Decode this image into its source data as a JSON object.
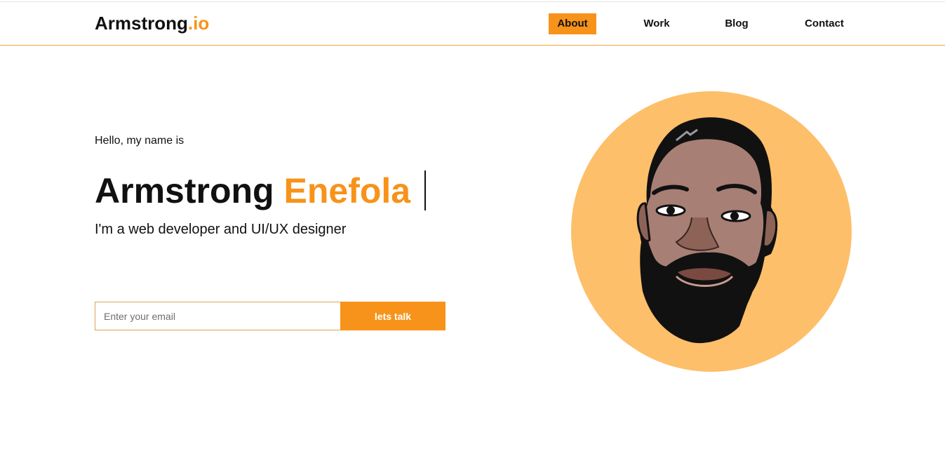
{
  "brand": {
    "name": "Armstrong",
    "suffix": ".io"
  },
  "nav": {
    "items": [
      {
        "label": "About",
        "active": true
      },
      {
        "label": "Work",
        "active": false
      },
      {
        "label": "Blog",
        "active": false
      },
      {
        "label": "Contact",
        "active": false
      }
    ]
  },
  "hero": {
    "greeting": "Hello, my name is",
    "first_name": "Armstrong",
    "last_name": "Enefola",
    "tagline": "I'm a web developer and UI/UX designer"
  },
  "contact_form": {
    "email_placeholder": "Enter your email",
    "email_value": "",
    "button_label": "lets talk"
  },
  "colors": {
    "accent": "#f7931a",
    "avatar_background": "#fdbf6a",
    "text": "#111111"
  },
  "icons": {
    "avatar": "cartoon-portrait-avatar"
  }
}
